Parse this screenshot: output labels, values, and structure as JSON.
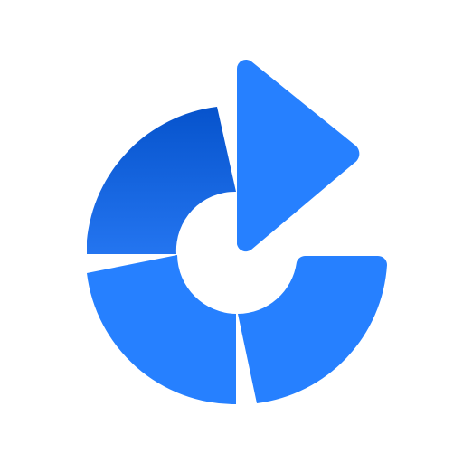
{
  "logo": {
    "icon": "circular-arrow-segmented-logo",
    "colors": {
      "background": "#ffffff",
      "primary": "#2680FF",
      "gradient_top": "#0653CC",
      "gradient_bottom": "#2475F0"
    }
  }
}
